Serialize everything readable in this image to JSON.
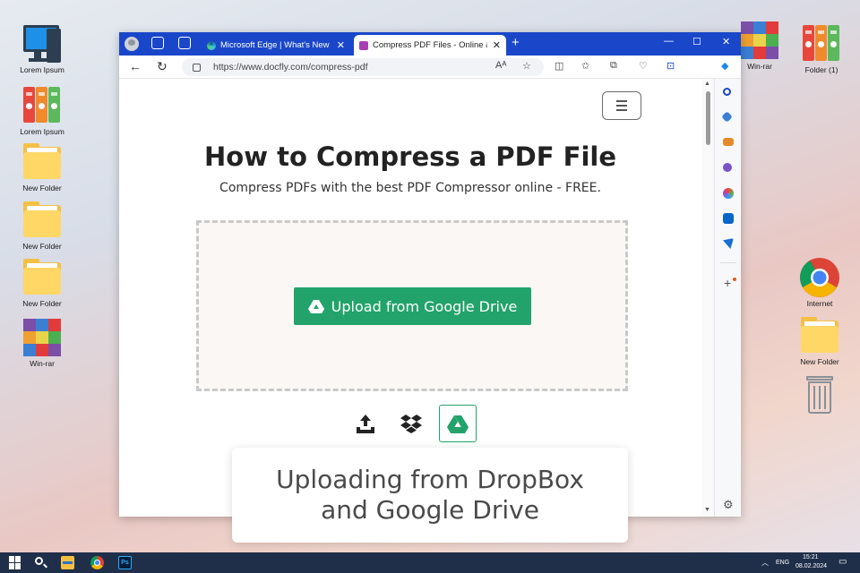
{
  "desktop": {
    "left_icons": [
      {
        "label": "Lorem Ipsum",
        "icon": "computer-icon"
      },
      {
        "label": "Lorem Ipsum",
        "icon": "binders-icon"
      },
      {
        "label": "New Folder",
        "icon": "folder-icon"
      },
      {
        "label": "New Folder",
        "icon": "folder-icon"
      },
      {
        "label": "New Folder",
        "icon": "folder-icon"
      },
      {
        "label": "Win-rar",
        "icon": "winrar-icon"
      }
    ],
    "right_icons": [
      {
        "label": "Win-rar",
        "icon": "winrar-icon"
      },
      {
        "label": "Folder (1)",
        "icon": "binders-icon"
      },
      {
        "label": "Internet",
        "icon": "chrome-icon"
      },
      {
        "label": "New Folder",
        "icon": "folder-icon"
      },
      {
        "label": "",
        "icon": "recycle-bin-icon"
      }
    ]
  },
  "browser": {
    "tabs": [
      {
        "title": "Microsoft Edge | What's New",
        "active": false
      },
      {
        "title": "Compress PDF Files - Online & F",
        "active": true
      }
    ],
    "url": "https://www.docfly.com/compress-pdf",
    "accent_color": "#1a47c9"
  },
  "page": {
    "title": "How to Compress a PDF File",
    "subtitle": "Compress PDFs with the best PDF Compressor online - FREE.",
    "upload_button": "Upload from Google Drive",
    "upload_button_color": "#22a36b",
    "sources": [
      {
        "icon": "upload-icon"
      },
      {
        "icon": "dropbox-icon"
      },
      {
        "icon": "google-drive-icon",
        "selected": true
      }
    ]
  },
  "caption": {
    "line1": "Uploading from DropBox",
    "line2": "and Google Drive"
  },
  "taskbar": {
    "language": "ENG",
    "time": "15:21",
    "date": "08.02.2024"
  }
}
